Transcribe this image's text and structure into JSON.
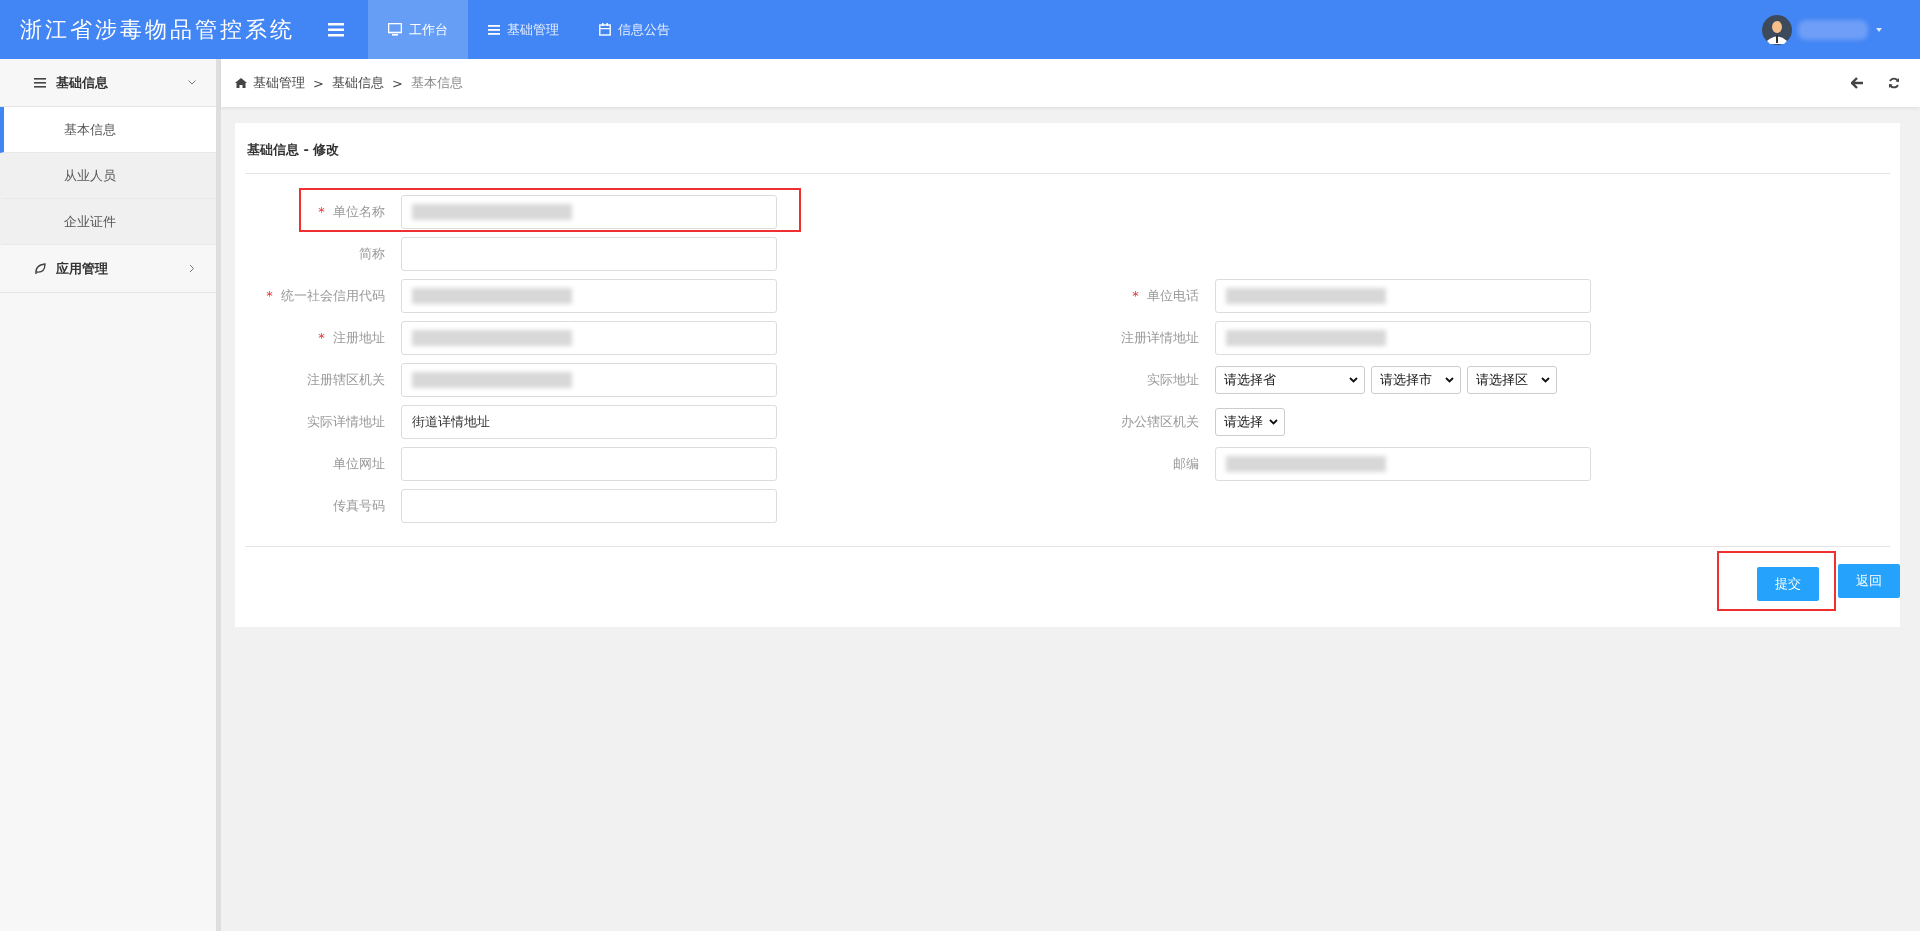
{
  "app_title": "浙江省涉毒物品管控系统",
  "nav_tabs": [
    {
      "label": "工作台",
      "selected": true
    },
    {
      "label": "基础管理",
      "selected": false
    },
    {
      "label": "信息公告",
      "selected": false
    }
  ],
  "user": {
    "name_redacted": true
  },
  "sidebar": {
    "items": [
      {
        "label": "基础信息",
        "expanded": true,
        "children": [
          {
            "label": "基本信息",
            "selected": true
          },
          {
            "label": "从业人员",
            "selected": false
          },
          {
            "label": "企业证件",
            "selected": false
          }
        ]
      },
      {
        "label": "应用管理",
        "expanded": false
      }
    ]
  },
  "breadcrumb": [
    {
      "label": "基础管理",
      "current": false
    },
    {
      "separator": ">",
      "label": "基础信息",
      "current": false
    },
    {
      "separator": ">",
      "label": "基本信息",
      "current": true
    }
  ],
  "card": {
    "title": "基础信息 - 修改",
    "left_fields": [
      {
        "required_mark": "*",
        "label": "单位名称",
        "kind": "text",
        "redacted": true,
        "highlighted": true
      },
      {
        "label": "简称",
        "kind": "text",
        "redacted": false
      },
      {
        "required_mark": "*",
        "label": "统一社会信用代码",
        "kind": "text",
        "redacted": true
      },
      {
        "required_mark": "*",
        "label": "注册地址",
        "kind": "text",
        "redacted": true
      },
      {
        "label": "注册辖区机关",
        "kind": "text",
        "redacted": true
      },
      {
        "label": "实际详情地址",
        "kind": "text",
        "redacted": false,
        "value": "街道详情地址"
      },
      {
        "label": "单位网址",
        "kind": "text",
        "redacted": false
      },
      {
        "label": "传真号码",
        "kind": "text",
        "redacted": false
      }
    ],
    "right_fields": [
      {
        "required_mark": "*",
        "label": "单位电话",
        "kind": "text",
        "redacted": true
      },
      {
        "label": "注册详情地址",
        "kind": "text",
        "redacted": true
      },
      {
        "label": "实际地址",
        "kind": "select",
        "selects": [
          {
            "value": "请选择省"
          },
          {
            "value": "请选择市"
          },
          {
            "value": "请选择区"
          }
        ]
      },
      {
        "label": "办公辖区机关",
        "kind": "select",
        "selects": [
          {
            "value": "请选择"
          }
        ]
      },
      {
        "label": "邮编",
        "kind": "text",
        "redacted": true
      }
    ],
    "buttons": [
      {
        "label": "提交",
        "highlighted": true
      },
      {
        "label": "返回",
        "highlighted": false
      }
    ]
  }
}
